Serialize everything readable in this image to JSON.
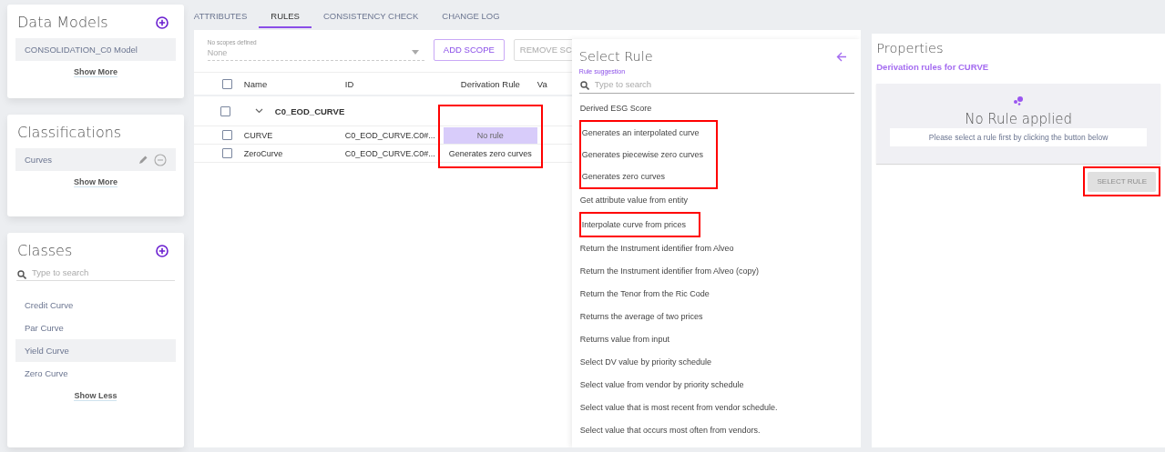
{
  "sidebar": {
    "data_models": {
      "title": "Data Models",
      "items": [
        {
          "label": "CONSOLIDATION_C0 Model",
          "selected": true
        }
      ],
      "toggle": "Show More"
    },
    "classifications": {
      "title": "Classifications",
      "items": [
        {
          "label": "Curves",
          "selected": true
        }
      ],
      "toggle": "Show More"
    },
    "classes": {
      "title": "Classes",
      "search": {
        "placeholder": "Type to search"
      },
      "items": [
        {
          "label": "Credit Curve",
          "selected": false
        },
        {
          "label": "Par Curve",
          "selected": false
        },
        {
          "label": "Yield Curve",
          "selected": true
        },
        {
          "label": "Zero Curve",
          "selected": false
        }
      ],
      "toggle": "Show Less"
    }
  },
  "tabs": [
    {
      "label": "ATTRIBUTES",
      "selected": false
    },
    {
      "label": "RULES",
      "selected": true
    },
    {
      "label": "CONSISTENCY CHECK",
      "selected": false
    },
    {
      "label": "CHANGE LOG",
      "selected": false
    }
  ],
  "scope": {
    "label": "No scopes defined",
    "value": "None",
    "buttons": [
      {
        "label": "ADD SCOPE",
        "disabled": false
      },
      {
        "label": "REMOVE SC",
        "disabled": true
      }
    ]
  },
  "table": {
    "columns": [
      "Name",
      "ID",
      "Derivation Rule",
      "Va"
    ],
    "all_checked": false,
    "derivation_highlighted": true,
    "group": {
      "name": "C0_EOD_CURVE",
      "expanded": true,
      "checked": false
    },
    "rows": [
      {
        "name": "CURVE",
        "id": "C0_EOD_CURVE.C0#...",
        "derivation": "No rule",
        "checked": false,
        "selected": true
      },
      {
        "name": "ZeroCurve",
        "id": "C0_EOD_CURVE.C0#...",
        "derivation": "Generates zero curves",
        "checked": false,
        "selected": false
      }
    ]
  },
  "select_rule": {
    "title": "Select Rule",
    "search": {
      "label": "Rule suggestion",
      "placeholder": "Type to search"
    },
    "items": [
      {
        "label": "Derived ESG Score",
        "highlighted": false
      },
      {
        "label": "Generates an interpolated curve",
        "highlighted": true
      },
      {
        "label": "Generates piecewise zero curves",
        "highlighted": true
      },
      {
        "label": "Generates zero curves",
        "highlighted": true
      },
      {
        "label": "Get attribute value from entity",
        "highlighted": false
      },
      {
        "label": "Interpolate curve from prices",
        "highlighted": true,
        "separate": true
      },
      {
        "label": "Return the Instrument identifier from Alveo",
        "highlighted": false
      },
      {
        "label": "Return the Instrument identifier from Alveo (copy)",
        "highlighted": false
      },
      {
        "label": "Return the Tenor from the Ric Code",
        "highlighted": false
      },
      {
        "label": "Returns the average of two prices",
        "highlighted": false
      },
      {
        "label": "Returns value from input",
        "highlighted": false
      },
      {
        "label": "Select DV value by priority schedule",
        "highlighted": false
      },
      {
        "label": "Select value from vendor by priority schedule",
        "highlighted": false
      },
      {
        "label": "Select value that is most recent from vendor schedule.",
        "highlighted": false
      },
      {
        "label": "Select value that occurs most often from vendors.",
        "highlighted": false
      }
    ]
  },
  "properties": {
    "title": "Properties",
    "subtitle": "Derivation rules for CURVE",
    "empty_title": "No Rule applied",
    "empty_message": "Please select a rule first by clicking the button below",
    "button": {
      "label": "SELECT RULE",
      "disabled": true,
      "highlighted": true
    }
  }
}
